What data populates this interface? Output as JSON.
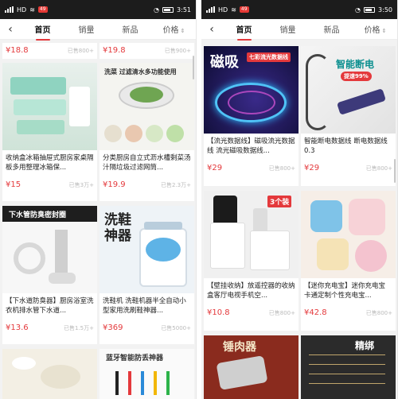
{
  "colors": {
    "accent": "#e4393c",
    "statusbar": "#1c1c1c"
  },
  "left": {
    "status": {
      "carrier": "HD",
      "time": "3:51",
      "badge": "49"
    },
    "tabs": [
      {
        "label": "首页",
        "active": true
      },
      {
        "label": "销量",
        "active": false
      },
      {
        "label": "新品",
        "active": false
      },
      {
        "label": "价格",
        "active": false
      }
    ],
    "top_row": [
      {
        "price": "¥18.8",
        "sold": "已售800+"
      },
      {
        "price": "¥19.8",
        "sold": "已售900+"
      }
    ],
    "cards": [
      {
        "title": "收纳盒冰箱抽屉式厨房家桌隔板多用整理冰箱保...",
        "price": "¥15",
        "sold": "已售3万+",
        "thumb_text": ""
      },
      {
        "title": "分类厨房自立式沥水槽剩菜汤汁隔垃圾过滤网筒...",
        "price": "¥19.9",
        "sold": "已售2.3万+",
        "thumb_text": "洗菜 过滤清水多功能使用"
      },
      {
        "title": "【下水道防臭器】厨房浴室洗衣机排水管下水道...",
        "price": "¥13.6",
        "sold": "已售1.5万+",
        "thumb_text": "下水管防臭密封圈"
      },
      {
        "title": "洗鞋机 洗鞋机器半全自动小型家用洗刷鞋神器...",
        "price": "¥369",
        "sold": "已售5000+",
        "thumb_text": "洗鞋神器"
      },
      {
        "title": "",
        "price": "",
        "sold": "",
        "thumb_text": ""
      },
      {
        "title": "",
        "price": "",
        "sold": "",
        "thumb_text": "蓝牙智能防丢神器"
      }
    ]
  },
  "right": {
    "status": {
      "carrier": "HD",
      "time": "3:50",
      "badge": "49"
    },
    "tabs": [
      {
        "label": "首页",
        "active": true
      },
      {
        "label": "销量",
        "active": false
      },
      {
        "label": "新品",
        "active": false
      },
      {
        "label": "价格",
        "active": false
      }
    ],
    "cards": [
      {
        "title": "【流光数据线】磁吸流光数据线 流光磁吸数据线...",
        "price": "¥29",
        "sold": "已售800+",
        "thumb_text": "磁吸",
        "thumb_sub": "七彩流光数据线"
      },
      {
        "title": "智能断电数据线 断电数据线 0.3",
        "price": "¥29",
        "sold": "已售800+",
        "thumb_text": "智能断电",
        "thumb_sub": "提速99%"
      },
      {
        "title": "【壁挂收纳】放遥控器的收纳盒客厅电视手机空...",
        "price": "¥10.8",
        "sold": "已售800+",
        "thumb_text": "3个装"
      },
      {
        "title": "【迷你充电宝】迷你充电宝 卡通定制个性充电宝...",
        "price": "¥42.8",
        "sold": "已售800+",
        "thumb_text": ""
      },
      {
        "title": "",
        "price": "",
        "sold": "",
        "thumb_text": "锤肉器"
      },
      {
        "title": "",
        "price": "",
        "sold": "",
        "thumb_text": "精绑"
      }
    ]
  }
}
